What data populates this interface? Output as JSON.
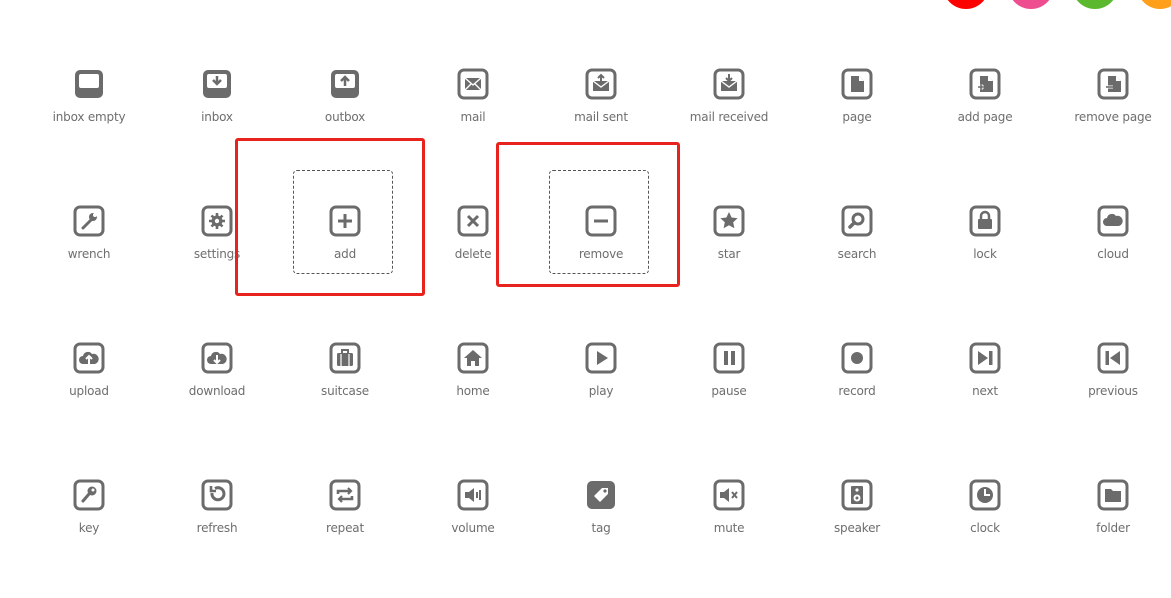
{
  "swatches": [
    {
      "name": "red",
      "color": "#ff0000"
    },
    {
      "name": "pink",
      "color": "#ee4d8f"
    },
    {
      "name": "green",
      "color": "#5cb82e"
    },
    {
      "name": "orange",
      "color": "#ff9f1a"
    }
  ],
  "icon_color": "#6b6b6b",
  "highlight_color": "#e8221c",
  "icons": [
    {
      "label": "inbox empty",
      "icon": "inbox-empty-icon"
    },
    {
      "label": "inbox",
      "icon": "inbox-icon"
    },
    {
      "label": "outbox",
      "icon": "outbox-icon"
    },
    {
      "label": "mail",
      "icon": "mail-icon"
    },
    {
      "label": "mail sent",
      "icon": "mail-sent-icon"
    },
    {
      "label": "mail received",
      "icon": "mail-received-icon"
    },
    {
      "label": "page",
      "icon": "page-icon"
    },
    {
      "label": "add page",
      "icon": "add-page-icon"
    },
    {
      "label": "remove page",
      "icon": "remove-page-icon"
    },
    {
      "label": "wrench",
      "icon": "wrench-icon"
    },
    {
      "label": "settings",
      "icon": "settings-icon"
    },
    {
      "label": "add",
      "icon": "add-icon",
      "highlighted": true
    },
    {
      "label": "delete",
      "icon": "delete-icon"
    },
    {
      "label": "remove",
      "icon": "remove-icon",
      "highlighted": true
    },
    {
      "label": "star",
      "icon": "star-icon"
    },
    {
      "label": "search",
      "icon": "search-icon"
    },
    {
      "label": "lock",
      "icon": "lock-icon"
    },
    {
      "label": "cloud",
      "icon": "cloud-icon"
    },
    {
      "label": "upload",
      "icon": "upload-icon"
    },
    {
      "label": "download",
      "icon": "download-icon"
    },
    {
      "label": "suitcase",
      "icon": "suitcase-icon"
    },
    {
      "label": "home",
      "icon": "home-icon"
    },
    {
      "label": "play",
      "icon": "play-icon"
    },
    {
      "label": "pause",
      "icon": "pause-icon"
    },
    {
      "label": "record",
      "icon": "record-icon"
    },
    {
      "label": "next",
      "icon": "next-icon"
    },
    {
      "label": "previous",
      "icon": "previous-icon"
    },
    {
      "label": "key",
      "icon": "key-icon"
    },
    {
      "label": "refresh",
      "icon": "refresh-icon"
    },
    {
      "label": "repeat",
      "icon": "repeat-icon"
    },
    {
      "label": "volume",
      "icon": "volume-icon"
    },
    {
      "label": "tag",
      "icon": "tag-icon"
    },
    {
      "label": "mute",
      "icon": "mute-icon"
    },
    {
      "label": "speaker",
      "icon": "speaker-icon"
    },
    {
      "label": "clock",
      "icon": "clock-icon"
    },
    {
      "label": "folder",
      "icon": "folder-icon"
    }
  ]
}
